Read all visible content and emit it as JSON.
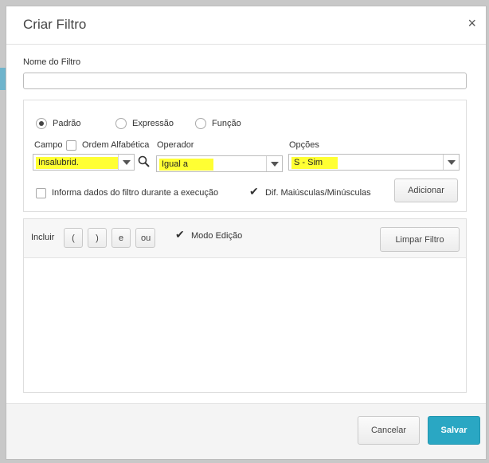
{
  "dialog": {
    "title": "Criar Filtro",
    "close_symbol": "×"
  },
  "filter_name": {
    "label": "Nome do Filtro",
    "value": ""
  },
  "mode": {
    "options": [
      {
        "label": "Padrão",
        "checked": true
      },
      {
        "label": "Expressão",
        "checked": false
      },
      {
        "label": "Função",
        "checked": false
      }
    ]
  },
  "campo": {
    "label": "Campo",
    "alphabetical_label": "Ordem Alfabética",
    "alphabetical_checked": false,
    "selected": "Insalubrid.",
    "search_icon": "magnifier-icon"
  },
  "operador": {
    "label": "Operador",
    "selected": "Igual a"
  },
  "opcoes": {
    "label": "Opções",
    "selected": "S - Sim"
  },
  "options_row": {
    "inform_label": "Informa dados do filtro durante a execução",
    "inform_checked": false,
    "case_label": "Dif. Maiúsculas/Minúsculas",
    "case_checked": true,
    "add_button": "Adicionar"
  },
  "expression_toolbar": {
    "include_label": "Incluir",
    "buttons": [
      "(",
      ")",
      "e",
      "ou"
    ],
    "edit_mode_label": "Modo Edição",
    "edit_mode_checked": true,
    "clear_button": "Limpar Filtro"
  },
  "footer": {
    "cancel": "Cancelar",
    "save": "Salvar"
  },
  "colors": {
    "primary": "#2aa7c3",
    "highlight": "#ffff33"
  }
}
